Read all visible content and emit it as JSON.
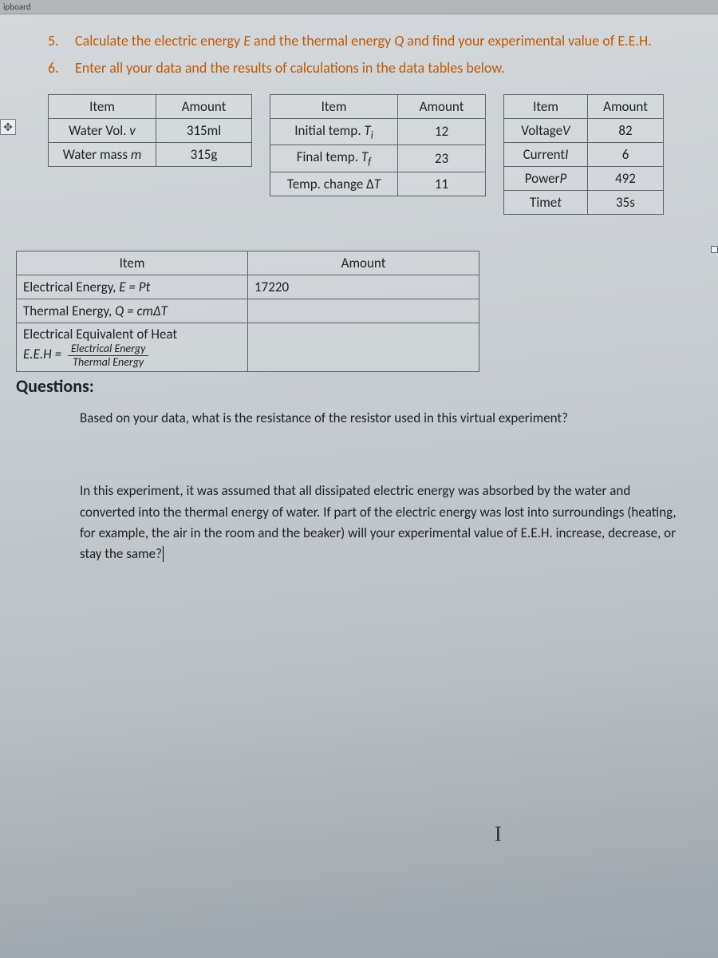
{
  "topLabel": "ipboard",
  "instructions": [
    {
      "num": "5.",
      "text_a": "Calculate the electric energy ",
      "text_ital_e": "E",
      "text_b": " and the thermal energy ",
      "text_ital_q": "Q",
      "text_c": " and find your experimental value of E.E.H."
    },
    {
      "num": "6.",
      "text_a": "Enter all your data and the results of calculations in the data tables below."
    }
  ],
  "hdr": {
    "item": "Item",
    "amount": "Amount"
  },
  "table1": {
    "rows": [
      {
        "item_a": "Water Vol. ",
        "item_i": "v",
        "amount": "315ml"
      },
      {
        "item_a": "Water mass ",
        "item_i": "m",
        "amount": "315g"
      }
    ]
  },
  "table2": {
    "rows": [
      {
        "item_a": "Initial temp. ",
        "item_i": "T",
        "item_sub": "i",
        "amount": "12"
      },
      {
        "item_a": "Final temp. ",
        "item_i": "T",
        "item_sub": "f",
        "amount": "23"
      },
      {
        "item_a": "Temp. change Δ",
        "item_i": "T",
        "amount": "11"
      }
    ]
  },
  "table3": {
    "rows": [
      {
        "item_a": "Voltage",
        "item_i": "V",
        "amount": "82"
      },
      {
        "item_a": "Current",
        "item_i": "I",
        "amount": "6"
      },
      {
        "item_a": "Power",
        "item_i": "P",
        "amount": "492"
      },
      {
        "item_a": "Time",
        "item_i": "t",
        "amount": "35s"
      }
    ]
  },
  "results": {
    "rows": [
      {
        "label_a": "Electrical Energy, ",
        "label_i": "E = Pt",
        "amount": "17220"
      },
      {
        "label_a": "Thermal Energy, ",
        "label_i": "Q = cmΔT",
        "amount": ""
      },
      {
        "label_a": "Electrical Equivalent of Heat",
        "label_line2_prefix": "E.E.H =",
        "frac_top": "Electrical Energy",
        "frac_bot": "Thermal Energy",
        "amount": ""
      }
    ]
  },
  "questionsHeader": "Questions:",
  "q1": "Based on your data, what is the resistance of the resistor used in this virtual experiment?",
  "q2": "In this experiment, it was assumed that all dissipated electric energy was absorbed by the water and converted into the thermal energy of water. If part of the electric energy was lost into surroundings (heating, for example, the air in the room and the beaker) will your experimental value of E.E.H. increase, decrease, or stay the same?",
  "plus": "✥",
  "ibeam": "I"
}
